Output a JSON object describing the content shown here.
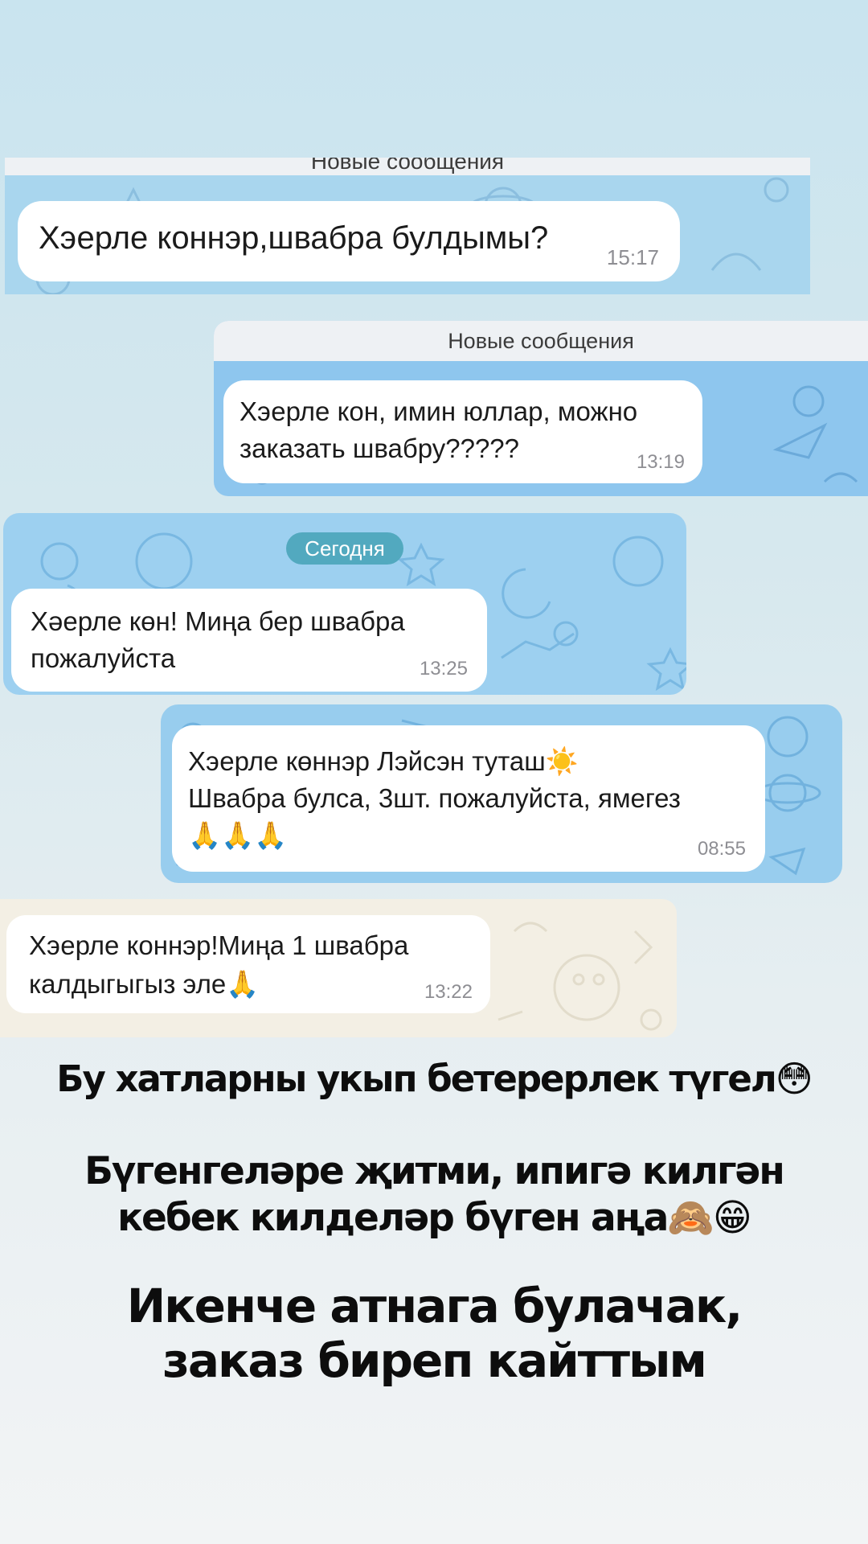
{
  "screenshot_1": {
    "separator_label": "Новые сообщения",
    "message": "Хэерле коннэр,швабра булдымы?",
    "time": "15:17"
  },
  "screenshot_2": {
    "separator_label": "Новые сообщения",
    "message": "Хэерле кон, имин юллар, можно\nзаказать швабру?????",
    "time": "13:19"
  },
  "screenshot_3": {
    "date_label": "Сегодня",
    "message": "Хәерле көн!  Миңа бер швабра\nпожалуйста",
    "time": "13:25"
  },
  "screenshot_4": {
    "message": "Хэерле көннэр Лэйсэн туташ☀️\nШвабра булса, 3шт. пожалуйста, ямегез\n🙏🙏🙏",
    "time": "08:55"
  },
  "screenshot_5": {
    "message": "Хэерле коннэр!Миңа 1 швабра\nкалдыгыгыз эле🙏",
    "time": "13:22"
  },
  "captions": {
    "line1": "Бу хатларны укып бетерерлек түгел😳",
    "line2": "Бүгенгеләре җитми, ипигә килгән\nкебек килделәр бүген аңа🙈😁",
    "line3": "Икенче атнага булачак,\nзаказ биреп кайттым"
  },
  "colors": {
    "chat_blue_1": "#a9d6ee",
    "chat_blue_2": "#8ec6ee",
    "chat_blue_3": "#9dd0f0",
    "chat_beige": "#f3efe4",
    "date_pill": "#52a9bf"
  }
}
